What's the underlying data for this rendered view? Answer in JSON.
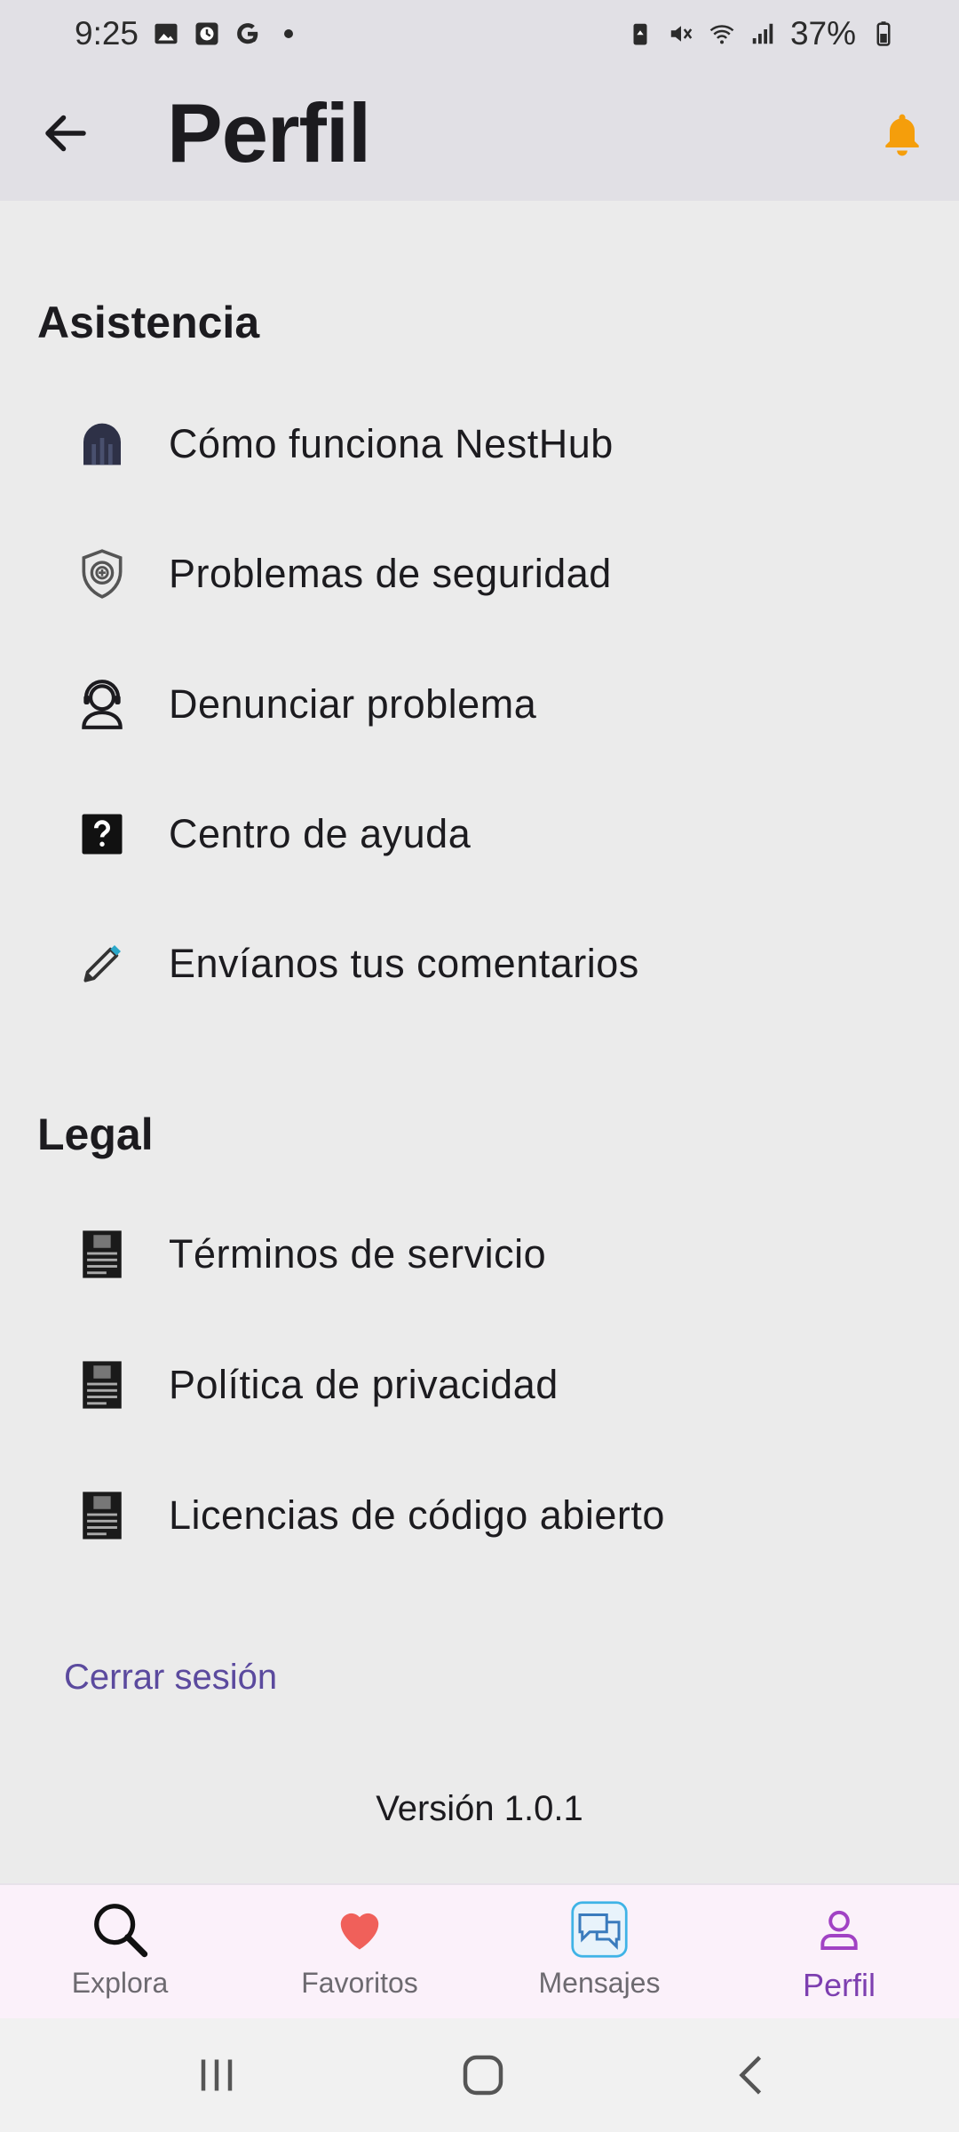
{
  "status_bar": {
    "time": "9:25",
    "battery": "37%",
    "left_icons": [
      "image-icon",
      "clock-icon",
      "google-icon",
      "dot-icon"
    ],
    "right_icons": [
      "battery-saver-icon",
      "mute-icon",
      "wifi-icon",
      "signal-icon",
      "battery-icon"
    ]
  },
  "app_bar": {
    "title": "Perfil",
    "back_icon": "arrow-back-icon",
    "notification_icon": "bell-icon",
    "accent_color": "#f59e0b"
  },
  "sections": {
    "support": {
      "heading": "Asistencia",
      "items": [
        {
          "label": "Cómo funciona NestHub",
          "icon": "nesthub-logo-icon"
        },
        {
          "label": "Problemas de seguridad",
          "icon": "shield-icon"
        },
        {
          "label": "Denunciar problema",
          "icon": "support-agent-icon"
        },
        {
          "label": "Centro de ayuda",
          "icon": "help-icon"
        },
        {
          "label": "Envíanos tus comentarios",
          "icon": "pencil-icon"
        }
      ]
    },
    "legal": {
      "heading": "Legal",
      "items": [
        {
          "label": "Términos de servicio",
          "icon": "document-icon"
        },
        {
          "label": "Política de privacidad",
          "icon": "document-icon"
        },
        {
          "label": "Licencias de código abierto",
          "icon": "document-icon"
        }
      ]
    }
  },
  "logout_label": "Cerrar sesión",
  "version": "Versión 1.0.1",
  "bottom_nav": {
    "items": [
      {
        "label": "Explora",
        "icon": "search-icon"
      },
      {
        "label": "Favoritos",
        "icon": "heart-icon"
      },
      {
        "label": "Mensajes",
        "icon": "chat-icon"
      },
      {
        "label": "Perfil",
        "icon": "person-icon"
      }
    ],
    "active": "Perfil",
    "active_color": "#7d3fb0",
    "heart_color": "#f0605a"
  },
  "system_nav": [
    "recents-icon",
    "home-icon",
    "back-icon"
  ]
}
